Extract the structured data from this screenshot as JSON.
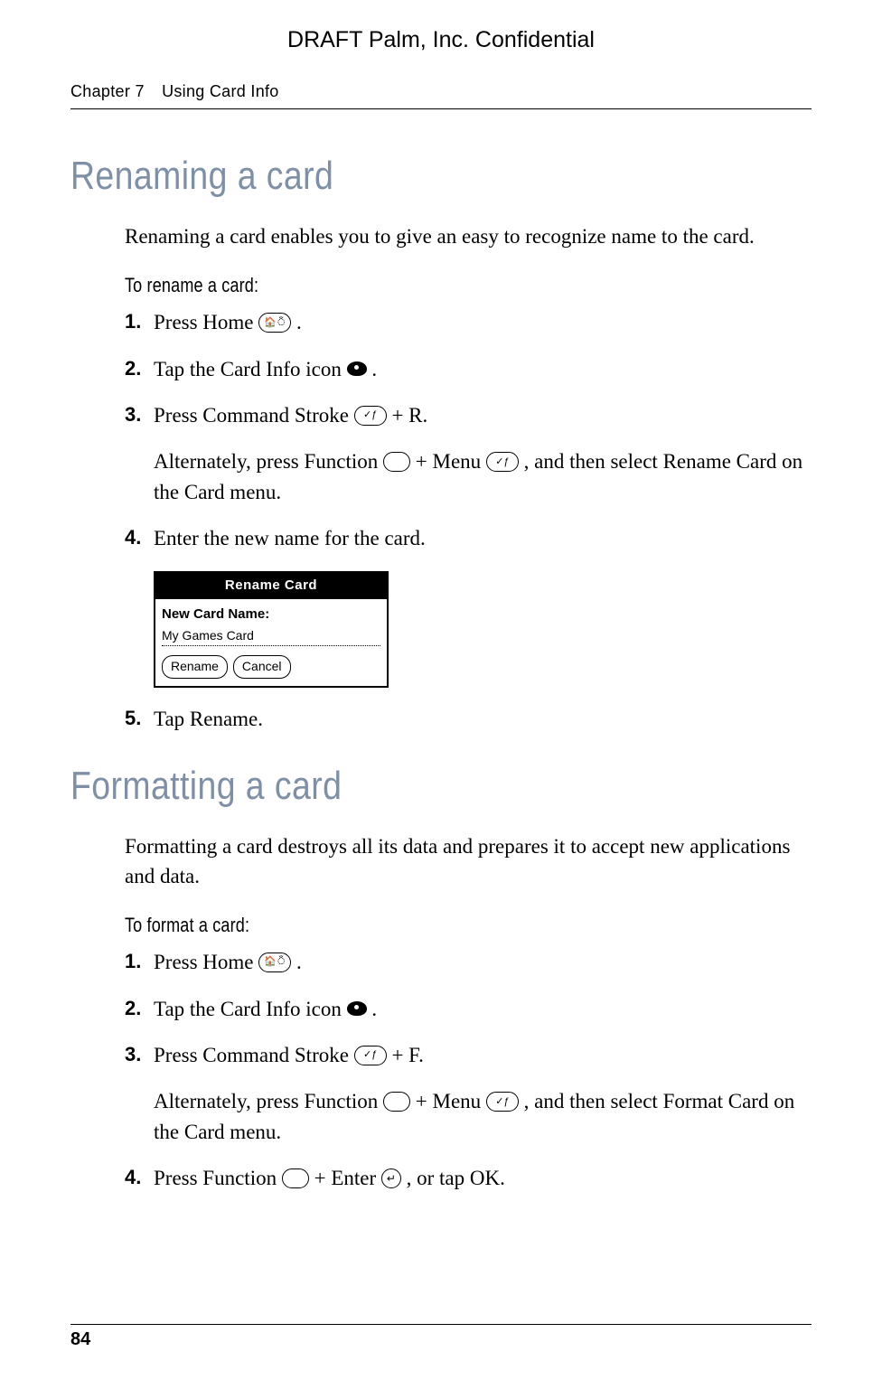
{
  "header": {
    "draft": "DRAFT   Palm, Inc. Confidential",
    "chapter_num": "Chapter 7",
    "chapter_title": "Using Card Info"
  },
  "section1": {
    "title": "Renaming a card",
    "intro": "Renaming a card enables you to give an easy to recognize name to the card.",
    "subhead": "To rename a card:",
    "steps": {
      "s1a": "Press Home ",
      "s1b": ".",
      "s2a": "Tap the Card Info icon ",
      "s2b": ".",
      "s3a": "Press Command Stroke ",
      "s3b": " + R.",
      "s3_alt_a": "Alternately, press Function ",
      "s3_alt_b": " + Menu ",
      "s3_alt_c": ", and then select Rename Card on the Card menu.",
      "s4": "Enter the new name for the card.",
      "s5": "Tap Rename."
    },
    "dialog": {
      "title": "Rename Card",
      "label": "New Card Name:",
      "value": "My Games Card",
      "btn_rename": "Rename",
      "btn_cancel": "Cancel"
    }
  },
  "section2": {
    "title": "Formatting a card",
    "intro": "Formatting a card destroys all its data and prepares it to accept new applications and data.",
    "subhead": "To format a card:",
    "steps": {
      "s1a": "Press Home ",
      "s1b": ".",
      "s2a": "Tap the Card Info icon ",
      "s2b": ".",
      "s3a": "Press Command Stroke ",
      "s3b": " + F.",
      "s3_alt_a": "Alternately, press Function ",
      "s3_alt_b": " + Menu ",
      "s3_alt_c": ", and then select Format Card on the Card menu.",
      "s4a": "Press Function ",
      "s4b": " + Enter ",
      "s4c": ", or tap OK."
    }
  },
  "footer": {
    "page_number": "84"
  }
}
